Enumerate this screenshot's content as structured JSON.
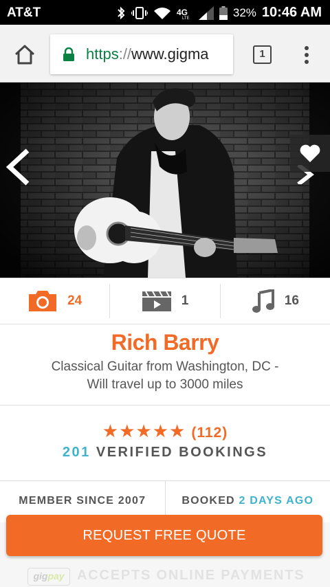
{
  "status_bar": {
    "carrier": "AT&T",
    "battery": "32%",
    "time": "10:46 AM",
    "network": "4G"
  },
  "browser": {
    "url_scheme": "https",
    "url_separator": "://",
    "url_host": "www.gigma",
    "tab_count": "1"
  },
  "media_counts": {
    "photos": "24",
    "videos": "1",
    "songs": "16"
  },
  "profile": {
    "name": "Rich Barry",
    "description_line1": "Classical Guitar from Washington, DC -",
    "description_line2": "Will travel up to 3000 miles"
  },
  "rating": {
    "stars": "★★★★★",
    "review_count": "(112)",
    "verified_count": "201",
    "verified_label": "VERIFIED BOOKINGS"
  },
  "meta": {
    "member_since": "MEMBER SINCE 2007",
    "booked_label": "BOOKED",
    "booked_value": "2 DAYS AGO"
  },
  "cta": {
    "label": "REQUEST FREE QUOTE"
  },
  "payments": {
    "logo_gig": "gig",
    "logo_pay": "pay",
    "label": "ACCEPTS ONLINE PAYMENTS"
  },
  "colors": {
    "accent": "#f26b26",
    "teal": "#3fb3c9",
    "url_green": "#0b8043"
  }
}
